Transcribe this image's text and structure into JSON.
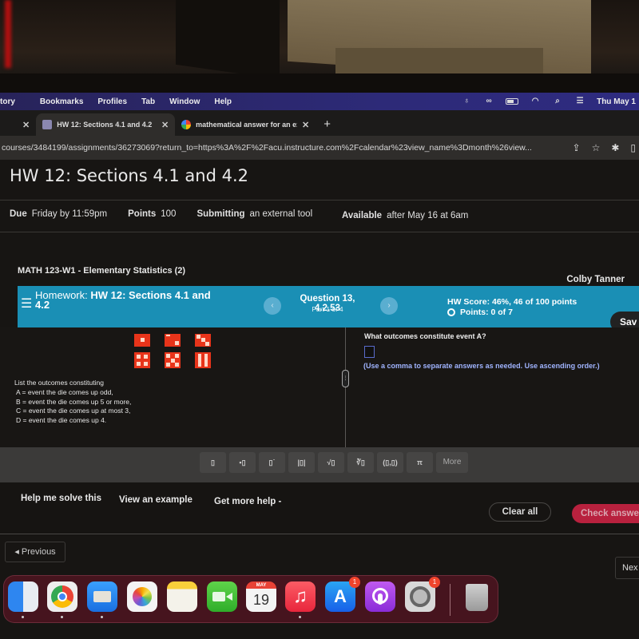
{
  "menubar": {
    "items": [
      "tory",
      "Bookmarks",
      "Profiles",
      "Tab",
      "Window",
      "Help"
    ],
    "status_icons": [
      "vpn-icon",
      "creative-cloud-icon",
      "battery-icon",
      "wifi-icon",
      "spotlight-search-icon",
      "control-center-icon"
    ],
    "clock": "Thu May 1"
  },
  "tabs": [
    {
      "label": "HW 12: Sections 4.1 and 4.2",
      "favicon": "canvas-favicon",
      "active": true
    },
    {
      "label": "mathematical answer for an ex",
      "favicon": "google-favicon",
      "active": false
    }
  ],
  "address_bar": {
    "url": "courses/3484199/assignments/36273069?return_to=https%3A%2F%2Facu.instructure.com%2Fcalendar%23view_name%3Dmonth%26view..."
  },
  "assignment": {
    "title": "HW 12: Sections 4.1 and 4.2",
    "due_label": "Due",
    "due_value": "Friday by 11:59pm",
    "points_label": "Points",
    "points_value": "100",
    "submitting_label": "Submitting",
    "submitting_value": "an external tool",
    "available_label": "Available",
    "available_value": "after May 16 at 6am"
  },
  "mymathlab": {
    "course": "MATH 123-W1 - Elementary Statistics (2)",
    "student": "Colby Tanner",
    "homework_prefix": "Homework:",
    "homework_title": "HW 12: Sections 4.1 and",
    "homework_title_line2": "4.2",
    "question": "Question 13, 4.2.53",
    "part": "Part 1 of 4",
    "hw_score": "HW Score: 46%, 46 of 100 points",
    "points": "Points: 0 of 7",
    "save_label": "Sav",
    "prev_arrow": "‹",
    "next_arrow": "›"
  },
  "question": {
    "dice_faces": [
      1,
      2,
      3,
      4,
      5,
      6
    ],
    "prompt_intro": "List the outcomes constituting",
    "events": [
      "A = event the die comes up odd,",
      "B = event the die comes up 5 or more,",
      "C = event the die comes up at most 3,",
      "D = event the die comes up 4."
    ],
    "ask": "What outcomes constitute event A?",
    "answer_value": "",
    "hint": "(Use a comma to separate answers as needed. Use ascending order.)"
  },
  "math_toolbar": {
    "buttons": [
      {
        "name": "fraction",
        "glyph": "▯"
      },
      {
        "name": "mixed-number",
        "glyph": "▪▯"
      },
      {
        "name": "exponent",
        "glyph": "▯˙"
      },
      {
        "name": "absolute-value",
        "glyph": "|▯|"
      },
      {
        "name": "square-root",
        "glyph": "√▯"
      },
      {
        "name": "nth-root",
        "glyph": "∛▯"
      },
      {
        "name": "ordered-pair",
        "glyph": "(▯,▯)"
      },
      {
        "name": "pi",
        "glyph": "π"
      },
      {
        "name": "more",
        "glyph": "More"
      }
    ]
  },
  "help": {
    "help_me_solve": "Help me solve this",
    "view_example": "View an example",
    "get_more_help": "Get more help -",
    "clear_all": "Clear all",
    "check_answer": "Check answe"
  },
  "nav": {
    "previous": "◂ Previous",
    "next": "Nex"
  },
  "dock": {
    "apps": [
      {
        "name": "finder",
        "badge": null,
        "running": true
      },
      {
        "name": "chrome",
        "badge": null,
        "running": true
      },
      {
        "name": "mail",
        "badge": null,
        "running": true
      },
      {
        "name": "photos",
        "badge": null,
        "running": false
      },
      {
        "name": "notes",
        "badge": null,
        "running": false
      },
      {
        "name": "facetime",
        "badge": null,
        "running": false
      },
      {
        "name": "calendar",
        "badge": null,
        "running": false,
        "month": "MAY",
        "day": "19"
      },
      {
        "name": "music",
        "badge": null,
        "running": true
      },
      {
        "name": "app-store",
        "badge": "1",
        "running": false
      },
      {
        "name": "podcasts",
        "badge": null,
        "running": false
      },
      {
        "name": "system-preferences",
        "badge": "1",
        "running": false
      },
      {
        "name": "trash",
        "badge": null,
        "running": false
      }
    ]
  },
  "colors": {
    "mymathlab_bar": "#1a8fb5",
    "check_answer": "#b8213e",
    "die_red": "#e8341a",
    "hint_blue": "#a0b4ff"
  }
}
